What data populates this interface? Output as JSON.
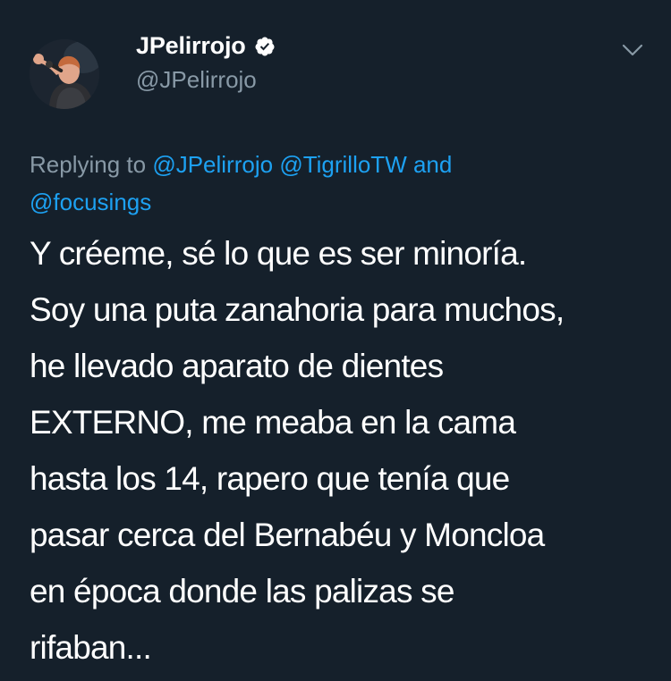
{
  "author": {
    "display_name": "JPelirrojo",
    "handle": "@JPelirrojo",
    "verified": true
  },
  "reply_context": {
    "prefix": "Replying to",
    "mentions": [
      "@JPelirrojo",
      "@TigrilloTW"
    ],
    "conjunction": "and",
    "last_mention": "@focusings"
  },
  "tweet": {
    "lines": [
      "Y créeme, sé lo que es ser minoría.",
      "Soy una puta zanahoria para muchos,",
      "he llevado aparato de dientes",
      "EXTERNO, me meaba en la cama",
      "hasta los 14, rapero que tenía que",
      "pasar cerca del Bernabéu y Moncloa",
      "en época donde las palizas se",
      "rifaban..."
    ]
  },
  "icons": {
    "verified": "verified-badge-icon",
    "menu": "chevron-down-icon"
  },
  "colors": {
    "background": "#15202b",
    "text": "#ffffff",
    "secondary_text": "#8899a6",
    "link": "#1da1f2"
  }
}
